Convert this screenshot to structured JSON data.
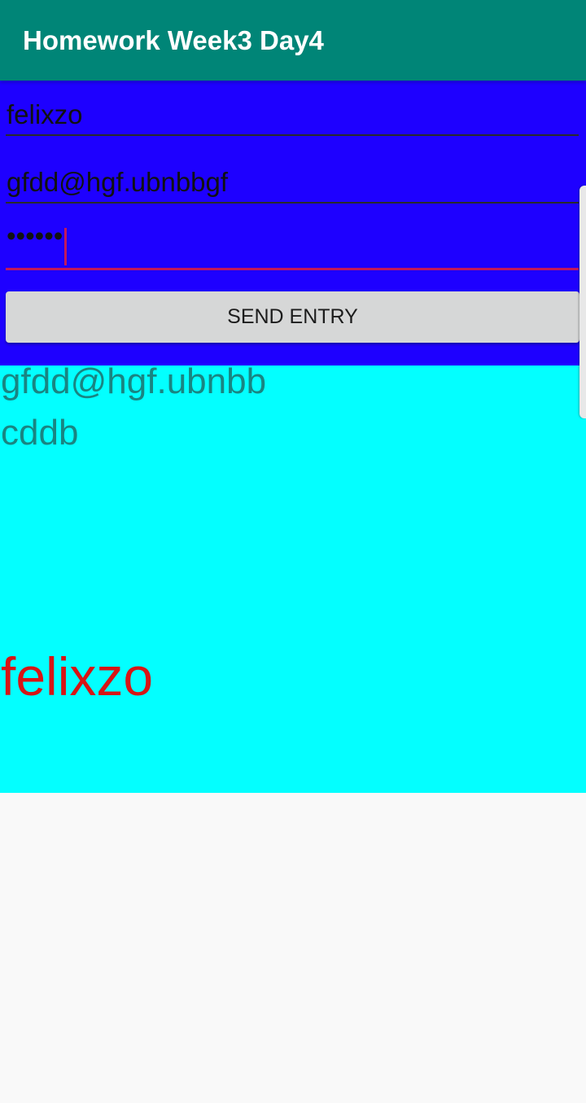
{
  "app_bar": {
    "title": "Homework Week3 Day4"
  },
  "form": {
    "username_value": "felixzo",
    "email_value": "gfdd@hgf.ubnbbgf",
    "password_value": "••••••",
    "send_button_label": "SEND ENTRY"
  },
  "output": {
    "email": "gfdd@hgf.ubnbb",
    "password": "cddb",
    "username": "felixzo"
  },
  "colors": {
    "app_bar": "#008577",
    "form_background": "#1e00ff",
    "output_background": "#03ffff",
    "accent": "#c2185b",
    "output_text": "#198582",
    "username_text": "#d71515",
    "button_background": "#d6d7d7"
  }
}
